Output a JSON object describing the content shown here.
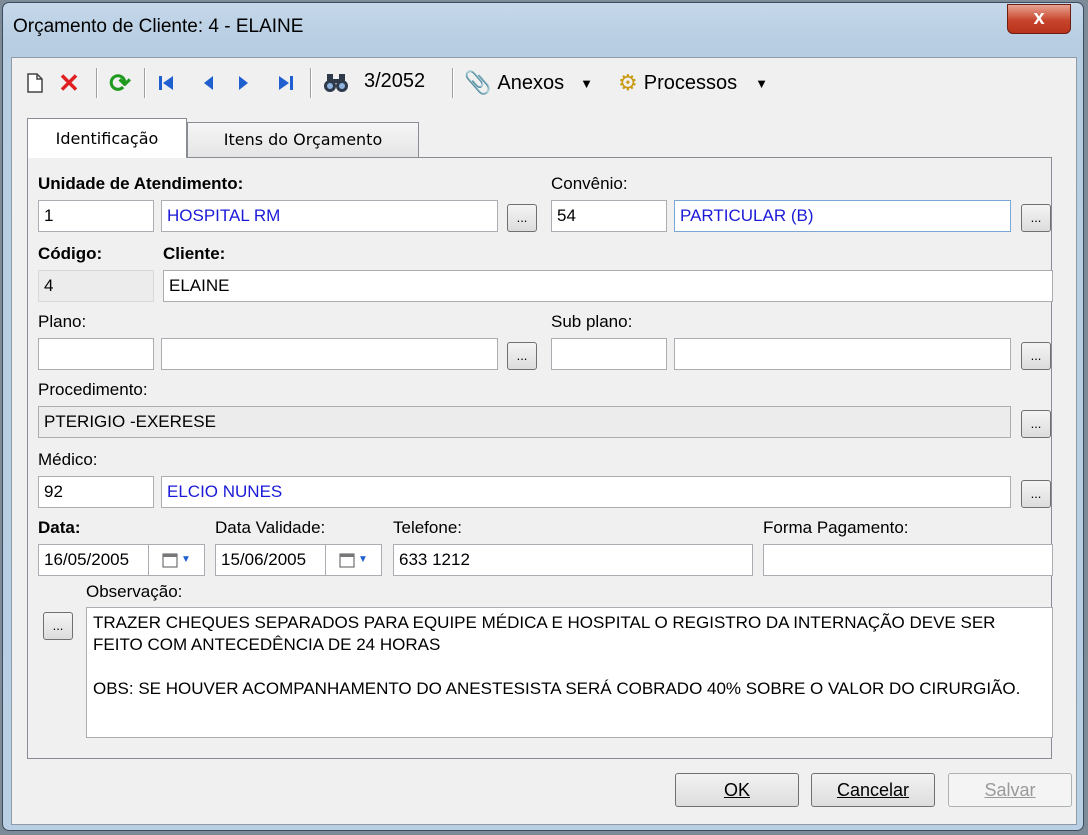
{
  "window": {
    "title": "Orçamento de Cliente: 4 - ELAINE",
    "close_label": "x"
  },
  "toolbar": {
    "counter": "3/2052",
    "anexos_label": "Anexos",
    "processos_label": "Processos"
  },
  "tabs": [
    {
      "label": "Identificação",
      "active": true
    },
    {
      "label": "Itens do Orçamento",
      "active": false
    }
  ],
  "form": {
    "unidade_label": "Unidade de Atendimento:",
    "unidade_code": "1",
    "unidade_name": "HOSPITAL RM",
    "convenio_label": "Convênio:",
    "convenio_code": "54",
    "convenio_name": "PARTICULAR (B)",
    "codigo_label": "Código:",
    "codigo_value": "4",
    "cliente_label": "Cliente:",
    "cliente_value": "ELAINE",
    "plano_label": "Plano:",
    "plano_code": "",
    "plano_name": "",
    "subplano_label": "Sub plano:",
    "subplano_code": "",
    "subplano_name": "",
    "procedimento_label": "Procedimento:",
    "procedimento_value": "PTERIGIO -EXERESE",
    "medico_label": "Médico:",
    "medico_code": "92",
    "medico_name": "ELCIO NUNES",
    "data_label": "Data:",
    "data_value": "16/05/2005",
    "validade_label": "Data Validade:",
    "validade_value": "15/06/2005",
    "telefone_label": "Telefone:",
    "telefone_value": "633 1212",
    "pagamento_label": "Forma Pagamento:",
    "pagamento_value": "",
    "observacao_label": "Observação:",
    "observacao_line1": "TRAZER CHEQUES SEPARADOS PARA EQUIPE MÉDICA E HOSPITAL O REGISTRO DA INTERNAÇÃO DEVE SER FEITO COM ANTECEDÊNCIA  DE 24 HORAS",
    "observacao_line2": "OBS: SE HOUVER ACOMPANHAMENTO DO ANESTESISTA SERÁ COBRADO 40% SOBRE O VALOR DO CIRURGIÃO.",
    "dots_label": "..."
  },
  "buttons": {
    "ok": "OK",
    "cancelar": "Cancelar",
    "salvar": "Salvar"
  },
  "colors": {
    "lookup_text": "#1a1ad8",
    "delete_icon": "#e02020",
    "refresh_icon": "#1f9a1f",
    "nav_icon": "#1f5fd0"
  }
}
